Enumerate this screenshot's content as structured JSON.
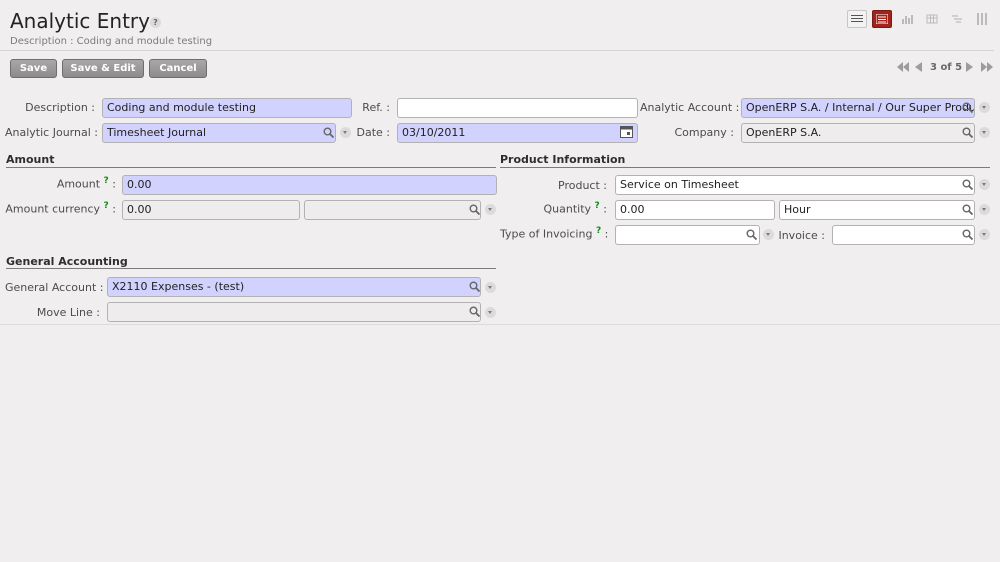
{
  "header": {
    "title": "Analytic Entry",
    "help_mark": "?",
    "subtitle": "Description : Coding and module testing"
  },
  "view_switcher": [
    "list-view-icon",
    "form-view-icon",
    "graph-view-icon",
    "calendar-view-icon",
    "gantt-view-icon",
    "kanban-view-icon"
  ],
  "toolbar": {
    "save_label": "Save",
    "save_edit_label": "Save & Edit",
    "cancel_label": "Cancel"
  },
  "pager": {
    "text": "3 of 5"
  },
  "fields": {
    "description": {
      "label": "Description :",
      "value": "Coding and module testing"
    },
    "ref": {
      "label": "Ref. :",
      "value": ""
    },
    "analytic_account": {
      "label": "Analytic Account :",
      "value": "OpenERP S.A. / Internal / Our Super Product"
    },
    "analytic_journal": {
      "label": "Analytic Journal :",
      "value": "Timesheet Journal"
    },
    "date": {
      "label": "Date :",
      "value": "03/10/2011"
    },
    "company": {
      "label": "Company :",
      "value": "OpenERP S.A."
    }
  },
  "amount_section": {
    "title": "Amount",
    "amount": {
      "label": "Amount",
      "help": "?",
      "colon": ":",
      "value": "0.00"
    },
    "amount_currency": {
      "label": "Amount currency",
      "help": "?",
      "colon": ":",
      "value": "0.00",
      "currency": ""
    }
  },
  "product_section": {
    "title": "Product Information",
    "product": {
      "label": "Product :",
      "value": "Service on Timesheet"
    },
    "quantity": {
      "label": "Quantity",
      "help": "?",
      "colon": ":",
      "value": "0.00",
      "uom": "Hour"
    },
    "invoicing": {
      "label": "Type of Invoicing",
      "help": "?",
      "colon": ":",
      "value": ""
    },
    "invoice": {
      "label": "Invoice :",
      "value": ""
    }
  },
  "accounting_section": {
    "title": "General Accounting",
    "general_account": {
      "label": "General Account :",
      "value": "X2110 Expenses - (test)"
    },
    "move_line": {
      "label": "Move Line :",
      "value": ""
    }
  },
  "colors": {
    "required_bg": "#d2d2ff",
    "active_view": "#a2231b",
    "help_green": "#0f8f0f"
  }
}
